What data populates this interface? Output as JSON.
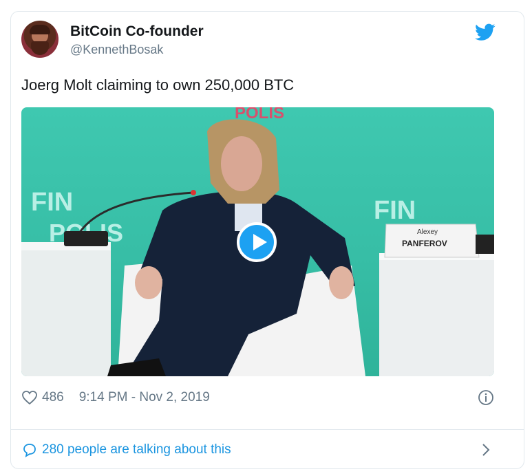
{
  "author": {
    "name": "BitCoin Co-founder",
    "handle": "@KennethBosak",
    "avatar": "user-avatar"
  },
  "tweet": {
    "text": "Joerg Molt claiming to own 250,000 BTC",
    "media": {
      "type": "video",
      "overlay_texts": {
        "sign_left": "FIN",
        "sign_left_sub": "POLIS",
        "sign_right": "FIN",
        "sign_top": "POLIS",
        "nameplate_first": "Alexey",
        "nameplate_last": "PANFEROV"
      },
      "play_icon": "play-icon"
    }
  },
  "footer": {
    "likes": "486",
    "timestamp": "9:14 PM - Nov 2, 2019",
    "heart_icon": "heart-icon",
    "info_icon": "info-icon"
  },
  "conversation": {
    "label": "280 people are talking about this",
    "bubble_icon": "speech-bubble-icon",
    "chevron_icon": "chevron-right-icon"
  },
  "colors": {
    "twitter_blue": "#1da1f2",
    "link_blue": "#1b95e0",
    "muted_gray": "#657786",
    "border": "#e1e8ed"
  }
}
